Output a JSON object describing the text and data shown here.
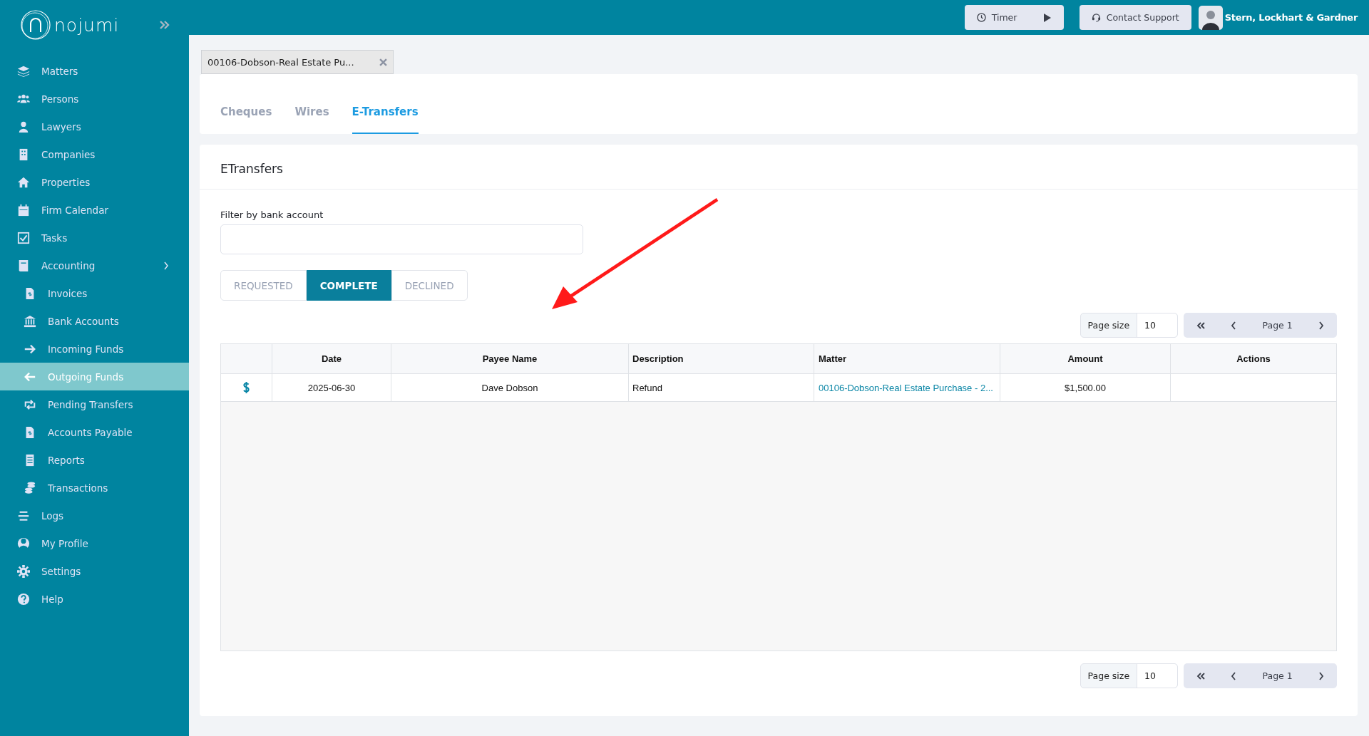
{
  "sidebar": {
    "logo_text": "nojumi",
    "items": [
      {
        "label": "Matters",
        "kind": "item",
        "selected": false
      },
      {
        "label": "Persons",
        "kind": "item",
        "selected": false
      },
      {
        "label": "Lawyers",
        "kind": "item",
        "selected": false
      },
      {
        "label": "Companies",
        "kind": "item",
        "selected": false
      },
      {
        "label": "Properties",
        "kind": "item",
        "selected": false
      },
      {
        "label": "Firm Calendar",
        "kind": "item",
        "selected": false
      },
      {
        "label": "Tasks",
        "kind": "item",
        "selected": false
      },
      {
        "label": "Accounting",
        "kind": "group",
        "selected": false
      },
      {
        "label": "Invoices",
        "kind": "sub",
        "selected": false
      },
      {
        "label": "Bank Accounts",
        "kind": "sub",
        "selected": false
      },
      {
        "label": "Incoming Funds",
        "kind": "sub",
        "selected": false
      },
      {
        "label": "Outgoing Funds",
        "kind": "sub",
        "selected": true
      },
      {
        "label": "Pending Transfers",
        "kind": "sub",
        "selected": false
      },
      {
        "label": "Accounts Payable",
        "kind": "sub",
        "selected": false
      },
      {
        "label": "Reports",
        "kind": "sub",
        "selected": false
      },
      {
        "label": "Transactions",
        "kind": "sub",
        "selected": false
      },
      {
        "label": "Logs",
        "kind": "item",
        "selected": false
      },
      {
        "label": "My Profile",
        "kind": "item",
        "selected": false
      },
      {
        "label": "Settings",
        "kind": "item",
        "selected": false
      },
      {
        "label": "Help",
        "kind": "item",
        "selected": false
      }
    ]
  },
  "header": {
    "timer_label": "Timer",
    "support_label": "Contact Support",
    "firm_name": "Stern, Lockhart & Gardner"
  },
  "document_tab": {
    "label": "00106-Dobson-Real Estate Pu..."
  },
  "tabs": [
    {
      "label": "Cheques",
      "selected": false
    },
    {
      "label": "Wires",
      "selected": false
    },
    {
      "label": "E-Transfers",
      "selected": true
    }
  ],
  "panel": {
    "title": "ETransfers",
    "filter_label": "Filter by bank account",
    "status_buttons": [
      {
        "label": "REQUESTED",
        "selected": false
      },
      {
        "label": "COMPLETE",
        "selected": true
      },
      {
        "label": "DECLINED",
        "selected": false
      }
    ]
  },
  "pagination_top": {
    "page_size_label": "Page size",
    "page_size": "10",
    "page_label": "Page 1"
  },
  "table": {
    "columns": [
      "Date",
      "Payee Name",
      "Description",
      "Matter",
      "Amount",
      "Actions"
    ],
    "rows": [
      {
        "date": "2025-06-30",
        "payee_name": "Dave Dobson",
        "description": "Refund",
        "matter": "00106-Dobson-Real Estate Purchase - 2...",
        "amount": "$1,500.00"
      }
    ]
  },
  "pagination_bottom": {
    "page_size_label": "Page size",
    "page_size": "10",
    "page_label": "Page 1"
  }
}
